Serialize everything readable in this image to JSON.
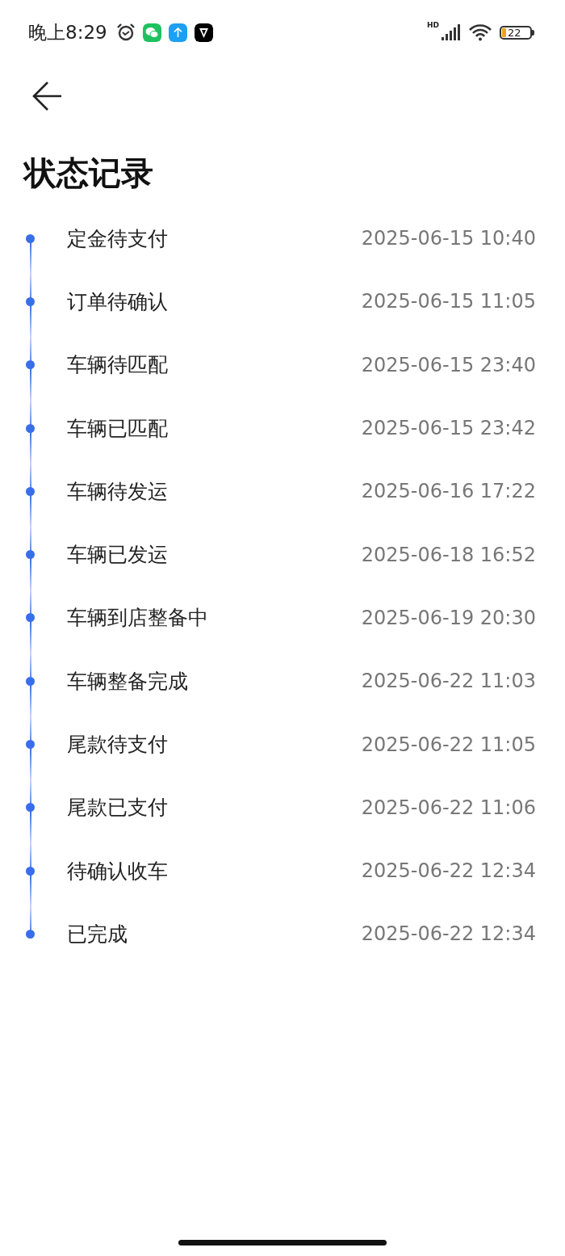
{
  "status_bar": {
    "time": "晚上8:29",
    "network": "HD",
    "battery": "22"
  },
  "page": {
    "title": "状态记录"
  },
  "records": [
    {
      "status": "定金待支付",
      "time": "2025-06-15 10:40"
    },
    {
      "status": "订单待确认",
      "time": "2025-06-15 11:05"
    },
    {
      "status": "车辆待匹配",
      "time": "2025-06-15 23:40"
    },
    {
      "status": "车辆已匹配",
      "time": "2025-06-15 23:42"
    },
    {
      "status": "车辆待发运",
      "time": "2025-06-16 17:22"
    },
    {
      "status": "车辆已发运",
      "time": "2025-06-18 16:52"
    },
    {
      "status": "车辆到店整备中",
      "time": "2025-06-19 20:30"
    },
    {
      "status": "车辆整备完成",
      "time": "2025-06-22 11:03"
    },
    {
      "status": "尾款待支付",
      "time": "2025-06-22 11:05"
    },
    {
      "status": "尾款已支付",
      "time": "2025-06-22 11:06"
    },
    {
      "status": "待确认收车",
      "time": "2025-06-22 12:34"
    },
    {
      "status": "已完成",
      "time": "2025-06-22 12:34"
    }
  ]
}
